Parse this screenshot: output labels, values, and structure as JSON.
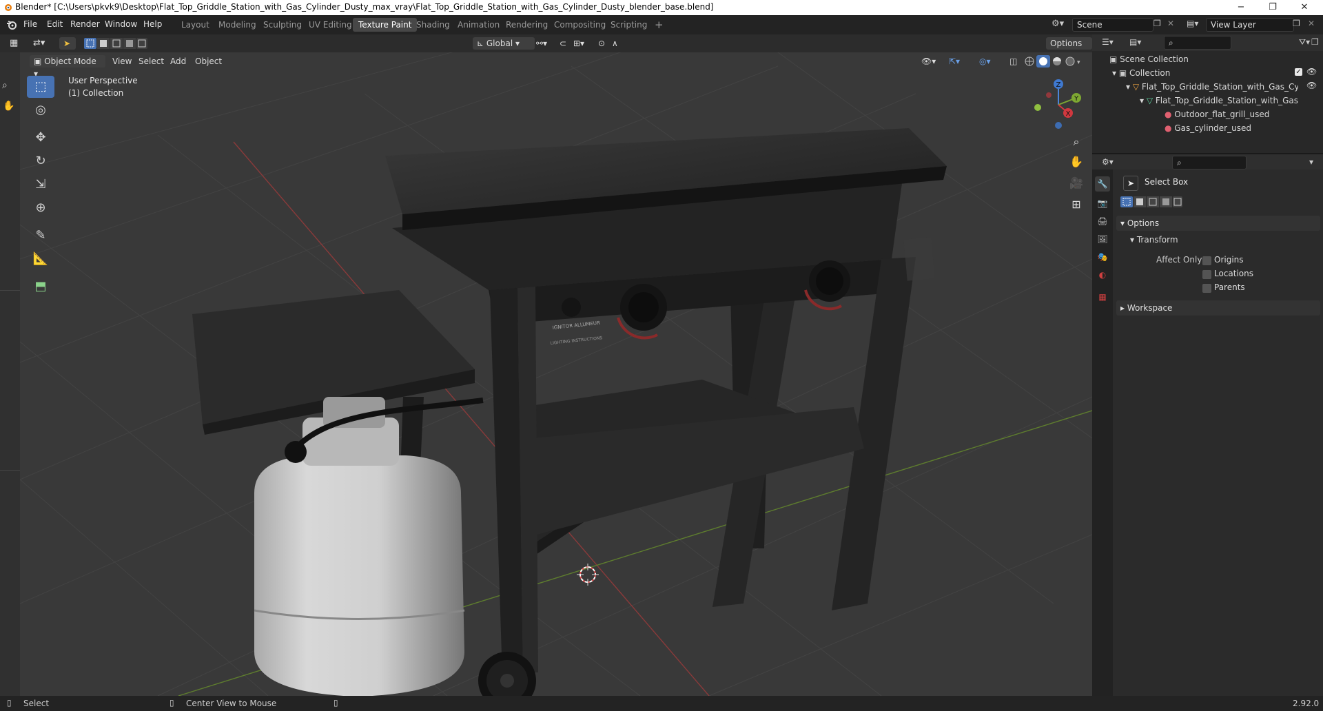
{
  "titlebar": {
    "title": "Blender* [C:\\Users\\pkvk9\\Desktop\\Flat_Top_Griddle_Station_with_Gas_Cylinder_Dusty_max_vray\\Flat_Top_Griddle_Station_with_Gas_Cylinder_Dusty_blender_base.blend]",
    "minimize": "−",
    "maximize": "❐",
    "close": "✕"
  },
  "menu": [
    "File",
    "Edit",
    "Render",
    "Window",
    "Help"
  ],
  "workspaces": [
    "Layout",
    "Modeling",
    "Sculpting",
    "UV Editing",
    "Texture Paint",
    "Shading",
    "Animation",
    "Rendering",
    "Compositing",
    "Scripting"
  ],
  "active_workspace": "Texture Paint",
  "add_workspace": "+",
  "scene": {
    "label": "Scene"
  },
  "view_layer": {
    "label": "View Layer"
  },
  "header": {
    "mode": "Object Mode",
    "view": "View",
    "select": "Select",
    "add": "Add",
    "object": "Object",
    "orientation": "Global",
    "options": "Options"
  },
  "viewport": {
    "perspective": "User Perspective",
    "collection": "(1) Collection"
  },
  "gizmo": {
    "z": "Z",
    "y": "Y",
    "x": "X"
  },
  "outliner": {
    "scene_collection": "Scene Collection",
    "collection": "Collection",
    "object": "Flat_Top_Griddle_Station_with_Gas_Cyli",
    "mesh": "Flat_Top_Griddle_Station_with_Gas_",
    "material1": "Outdoor_flat_grill_used",
    "material2": "Gas_cylinder_used"
  },
  "properties": {
    "tool": "Select Box",
    "options": "Options",
    "transform": "Transform",
    "affect_only": "Affect Only",
    "origins": "Origins",
    "locations": "Locations",
    "parents": "Parents",
    "workspace": "Workspace"
  },
  "statusbar": {
    "select": "Select",
    "center_view": "Center View to Mouse",
    "version": "2.92.0"
  },
  "griddle_labels": {
    "brand": "IGNITOR ALLUMEUR",
    "instructions": "LIGHTING INSTRUCTIONS"
  }
}
